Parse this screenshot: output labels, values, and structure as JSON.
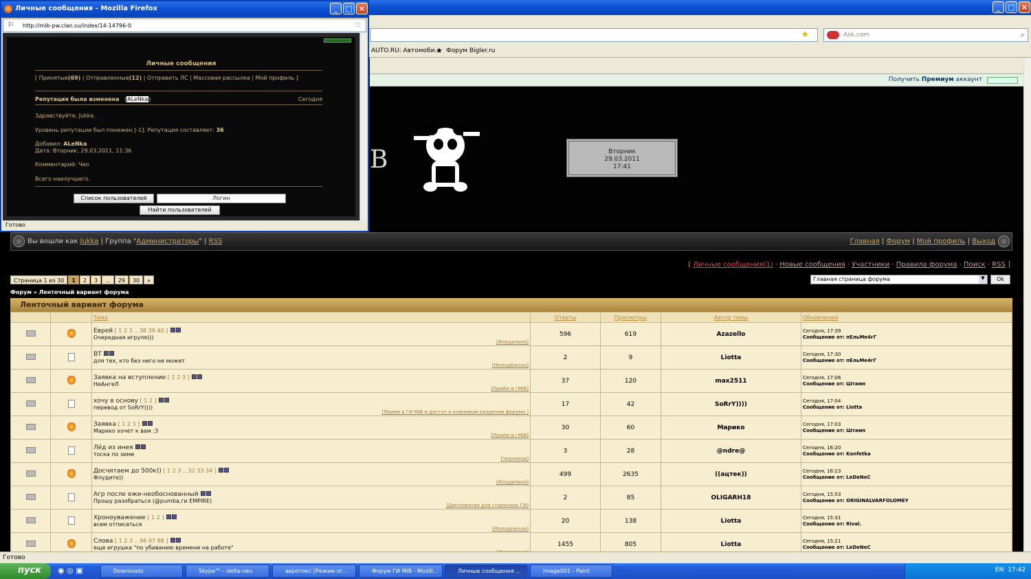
{
  "popup": {
    "title": "Личные сообщения - Mozilla Firefox",
    "url": "http://mib-pw.clan.su/index/14-14796-0",
    "status": "Готово",
    "heading": "Личные сообщения",
    "nav": {
      "bracket_open": "[",
      "received_label": "Принятые",
      "received_count": "(69)",
      "sent_label": "Отправленные",
      "sent_count": "(12)",
      "send_pm": "Отправить ЛС",
      "mass_mail": "Массовая рассылка",
      "my_profile": "Мой профиль",
      "bracket_close": "]"
    },
    "message": {
      "subject": "Репутация была изменена",
      "from_user": "ALeNka",
      "date_label": "Сегодня",
      "greeting": "Здравствуйте, Jukka.",
      "body_prefix": "Уровень репутации был понижен [-1]. Репутация составляет:",
      "body_value": "36",
      "added_by_label": "Добавил:",
      "added_by": "ALeNka",
      "date_full": "Дата: Вторник, 29.03.2011, 11:36",
      "comment": "Комментарий: Чио",
      "closing": "Всего наилучшего."
    },
    "user_list_button": "Список пользователей",
    "login_placeholder": "Логин",
    "find_users_button": "Найти пользователей"
  },
  "browser": {
    "search_placeholder": "Ask.com",
    "bookmarks": [
      "AUTO.RU: Автомоби...",
      "Форум Bigler.ru"
    ],
    "premium_prefix": "Получить",
    "premium_bold": "Премиум",
    "premium_suffix": "аккаунт",
    "status": "Готово"
  },
  "header": {
    "letter": "B",
    "weekday": "Вторник",
    "date": "29.03.2011",
    "time": "17:41"
  },
  "login_bar": {
    "prefix": "Вы вошли как",
    "user": "Jukka",
    "group_prefix": "| Группа \"",
    "group": "Администраторы",
    "group_suffix": "\" |",
    "rss": "RSS",
    "links": [
      "Главная",
      "Форум",
      "Мой профиль",
      "Выход"
    ]
  },
  "user_links": {
    "pm": "Личные сообщения(1)",
    "items": [
      "Новые сообщения",
      "Участники",
      "Правила форума",
      "Поиск",
      "RSS"
    ]
  },
  "pager": {
    "label": "Страница 1 из 30",
    "pages": [
      "1",
      "2",
      "3",
      "...",
      "29",
      "30",
      "»"
    ]
  },
  "jump": {
    "selected": "Главная страница форума",
    "ok": "Ok"
  },
  "breadcrumb": {
    "root": "Форум",
    "sep": "»",
    "current": "Ленточный вариант форума"
  },
  "forum": {
    "title": "Ленточный вариант форума",
    "columns": [
      "Тема",
      "Ответы",
      "Просмотры",
      "Автор темы",
      "Обновления"
    ],
    "rows": [
      {
        "title": "Еврей",
        "pages": "[ 1 2 3 .. 38 39 40 ]",
        "desc": "Очередная игруля)))",
        "sub": "[Флудильня]",
        "replies": "596",
        "views": "619",
        "author": "Azazello",
        "time": "Сегодня, 17:39",
        "last_by": "Сообщение от: пЕльМе4гГ",
        "hot": true
      },
      {
        "title": "ВТ",
        "pages": "",
        "desc": "для тех, кто без него не может",
        "sub": "[Молодёжная]",
        "replies": "2",
        "views": "9",
        "author": "Liotta",
        "time": "Сегодня, 17:30",
        "last_by": "Сообщение от: пЕльМе4гГ",
        "hot": false
      },
      {
        "title": "Заявка на вступление",
        "pages": "[ 1 2 3 ]",
        "desc": "НеАнгеЛ",
        "sub": "[Приём в гМiB]",
        "replies": "37",
        "views": "120",
        "author": "max2511",
        "time": "Сегодня, 17:06",
        "last_by": "Сообщение от: Штамп",
        "hot": true
      },
      {
        "title": "хочу в основу",
        "pages": "[ 1 2 ]",
        "desc": "перевод от SoRrY))))",
        "sub": "[Прием в ГИ MiB и доступ к клановым разделам форума.]",
        "replies": "17",
        "views": "42",
        "author": "SoRrY))))",
        "time": "Сегодня, 17:04",
        "last_by": "Сообщение от: Liotta",
        "hot": false
      },
      {
        "title": "Заявка",
        "pages": "[ 1 2 3 ]",
        "desc": "Марико хочет к вам :3",
        "sub": "[Приём в гМiB]",
        "replies": "30",
        "views": "60",
        "author": "Марико",
        "time": "Сегодня, 17:03",
        "last_by": "Сообщение от: Штамп",
        "hot": true
      },
      {
        "title": "Лёд из инея",
        "pages": "",
        "desc": "тоска по зиме",
        "sub": "[Черняхов]",
        "replies": "3",
        "views": "28",
        "author": "@ndre@",
        "time": "Сегодня, 16:20",
        "last_by": "Сообщение от: Konfetka",
        "hot": false
      },
      {
        "title": "Досчитаем до 500к))",
        "pages": "[ 1 2 3 .. 32 33 34 ]",
        "desc": "Флудите))",
        "sub": "[Флудильня]",
        "replies": "499",
        "views": "2635",
        "author": "((ацтек))",
        "time": "Сегодня, 16:13",
        "last_by": "Сообщение от: LeDeNeC",
        "hot": true
      },
      {
        "title": "Агр после ежи-необоснованный",
        "pages": "",
        "desc": "Прошу разобраться (@pumba,ги EMPIRE)",
        "sub": "[Дипломатия для сторонних ГИ]",
        "replies": "2",
        "views": "85",
        "author": "OLIGARH18",
        "time": "Сегодня, 15:53",
        "last_by": "Сообщение от: ORIGINALVARFOLOMEY",
        "hot": false
      },
      {
        "title": "Хроноуважение",
        "pages": "[ 1 2 ]",
        "desc": "всем отписаться",
        "sub": "[Молодёжная]",
        "replies": "20",
        "views": "138",
        "author": "Liotta",
        "time": "Сегодня, 15:31",
        "last_by": "Сообщение от: Rival.",
        "hot": false
      },
      {
        "title": "Слова",
        "pages": "[ 1 2 3 .. 96 97 98 ]",
        "desc": "еще игрушка \"по убиванию времени на работе\"",
        "sub": "[Флудильня]",
        "replies": "1455",
        "views": "805",
        "author": "Liotta",
        "time": "Сегодня, 15:21",
        "last_by": "Сообщение от: LeDeNeC",
        "hot": true
      }
    ]
  },
  "taskbar": {
    "start": "пуск",
    "tasks": [
      "Downloads",
      "Skype™ - delta-neu",
      "авротокс [Режим ог...",
      "Форум ГИ MiB - Mozill...",
      "Личные сообщения ...",
      "image001 - Paint"
    ],
    "active_index": 4,
    "lang": "EN",
    "clock": "17:42"
  }
}
